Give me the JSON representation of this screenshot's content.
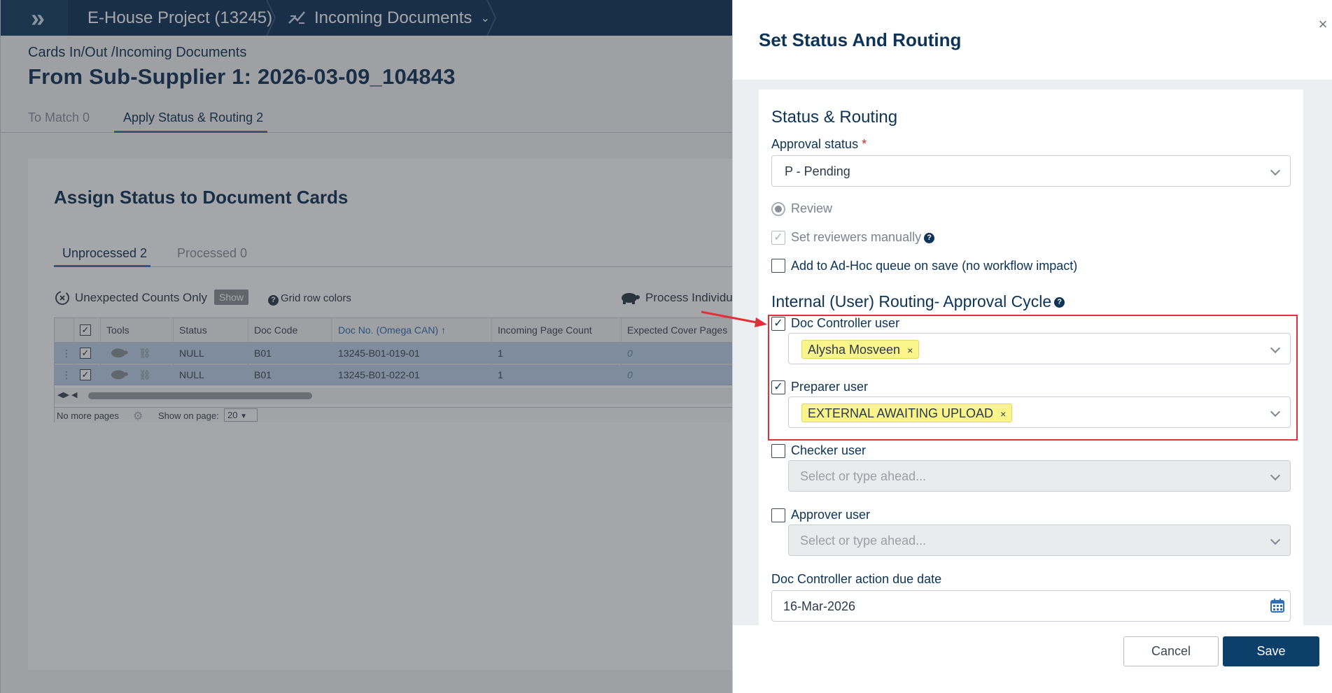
{
  "topbar": {
    "project": "E-House Project (13245)",
    "section": "Incoming Documents"
  },
  "page": {
    "breadcrumb": "Cards In/Out /Incoming Documents",
    "title": "From Sub-Supplier 1: 2026-03-09_104843",
    "tabs": [
      {
        "label": "To Match 0",
        "active": false
      },
      {
        "label": "Apply Status & Routing 2",
        "active": true
      }
    ]
  },
  "assign": {
    "title": "Assign Status to Document Cards",
    "tabs": [
      {
        "label": "Unprocessed 2",
        "active": true
      },
      {
        "label": "Processed 0",
        "active": false
      }
    ],
    "toolbar": {
      "unexpected_label": "Unexpected Counts Only",
      "show_label": "Show",
      "grid_colors_label": "Grid row colors",
      "process_label": "Process Individu"
    }
  },
  "grid": {
    "columns": [
      "Tools",
      "Status",
      "Doc Code",
      "Doc No. (Omega CAN)",
      "Incoming Page Count",
      "Expected Cover Pages"
    ],
    "rows": [
      {
        "status": "NULL",
        "doc_code": "B01",
        "doc_no": "13245-B01-019-01",
        "incoming": "1",
        "expected": "0"
      },
      {
        "status": "NULL",
        "doc_code": "B01",
        "doc_no": "13245-B01-022-01",
        "incoming": "1",
        "expected": "0"
      }
    ],
    "footer": {
      "no_more_pages": "No more pages",
      "show_on_page": "Show on page:",
      "page_size": "20"
    }
  },
  "drawer": {
    "title": "Set Status And Routing",
    "status_section": "Status & Routing",
    "approval_status_label": "Approval status",
    "approval_status_required": "*",
    "approval_status_value": "P - Pending",
    "review_label": "Review",
    "set_reviewers_label": "Set reviewers manually",
    "adhoc_label": "Add to Ad-Hoc queue on save (no workflow impact)",
    "routing_section": "Internal (User) Routing- Approval Cycle",
    "doc_controller_label": "Doc Controller user",
    "doc_controller_tag": "Alysha Mosveen",
    "preparer_label": "Preparer user",
    "preparer_tag": "EXTERNAL AWAITING UPLOAD",
    "checker_label": "Checker user",
    "checker_placeholder": "Select or type ahead...",
    "approver_label": "Approver user",
    "approver_placeholder": "Select or type ahead...",
    "due_date_label": "Doc Controller action due date",
    "due_date_value": "16-Mar-2026",
    "cancel_label": "Cancel",
    "save_label": "Save",
    "tag_remove": "×",
    "close": "×"
  },
  "colors": {
    "navy": "#0d3356",
    "highlight_red": "#e0303a",
    "tag_yellow": "#fbf48a",
    "row_selected": "#bcd3ea"
  }
}
